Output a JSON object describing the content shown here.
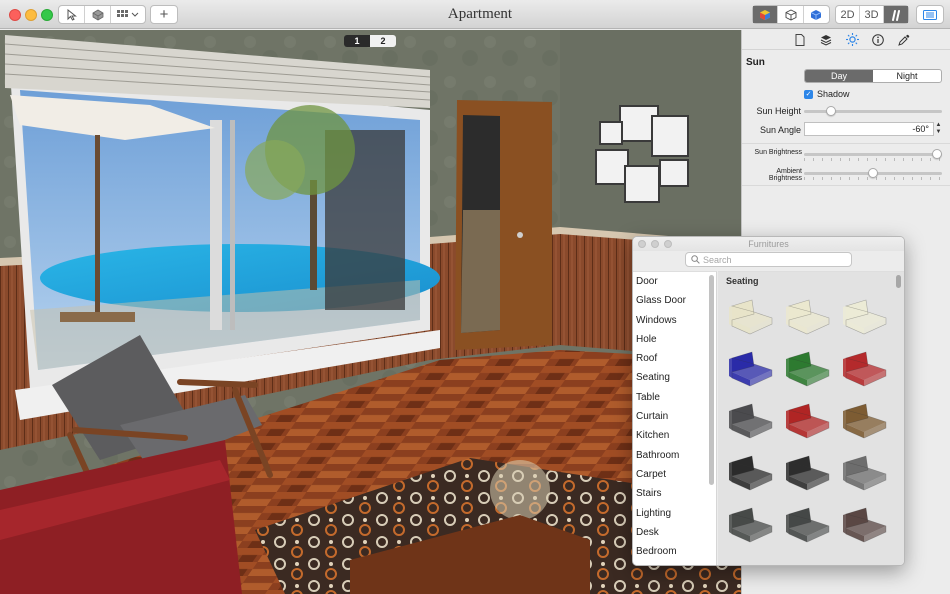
{
  "window": {
    "title": "Apartment"
  },
  "toolbar": {
    "left_buttons": [
      {
        "icon": "pointer-arrow-icon"
      },
      {
        "icon": "draw-wall-icon"
      },
      {
        "icon": "view-options-icon"
      },
      {
        "icon": "add-plus-icon",
        "label": "+"
      }
    ],
    "render_modes": [
      "solid-render-icon",
      "wireframe-render-icon",
      "textured-render-icon"
    ],
    "view_2d_label": "2D",
    "view_3d_label": "3D",
    "walk_icon": "walk-mode-icon",
    "sidebar_toggle_icon": "sidebar-toggle-icon"
  },
  "viewport": {
    "pages": [
      "1",
      "2"
    ],
    "active_page": "1"
  },
  "inspector": {
    "tab_icons": [
      "document-icon",
      "layers-icon",
      "sun-icon",
      "info-icon",
      "eyedropper-icon"
    ],
    "active_tab": "sun-icon",
    "heading": "Sun",
    "mode_options": [
      "Day",
      "Night"
    ],
    "mode_selected": "Day",
    "shadow_label": "Shadow",
    "shadow_checked": true,
    "sun_height_label": "Sun Height",
    "sun_height_value": 0.17,
    "sun_angle_label": "Sun Angle",
    "sun_angle_value": "-60°",
    "sun_brightness_label": "Sun Brightness",
    "sun_brightness_value": 1.0,
    "ambient_brightness_label": "Ambient Brightness",
    "ambient_brightness_value": 0.5
  },
  "furniture_panel": {
    "title": "Furnitures",
    "search_placeholder": "Search",
    "categories": [
      "Door",
      "Glass Door",
      "Windows",
      "Hole",
      "Roof",
      "Seating",
      "Table",
      "Curtain",
      "Kitchen",
      "Bathroom",
      "Carpet",
      "Stairs",
      "Lighting",
      "Desk",
      "Bedroom"
    ],
    "selected_category": "Seating",
    "section_title": "Seating",
    "items": [
      {
        "name": "white-armchair",
        "color": "#e8e4c9"
      },
      {
        "name": "white-loveseat",
        "color": "#ebe8cf"
      },
      {
        "name": "white-sofa",
        "color": "#ecebd6"
      },
      {
        "name": "blue-armchair",
        "color": "#2a2ba8"
      },
      {
        "name": "green-loveseat",
        "color": "#2d7a30"
      },
      {
        "name": "red-sofa",
        "color": "#b42a2c"
      },
      {
        "name": "gray-chaise",
        "color": "#4b4b4e"
      },
      {
        "name": "red-sectional",
        "color": "#b02524"
      },
      {
        "name": "brown-ottoman",
        "color": "#7d5c33"
      },
      {
        "name": "black-loveseat",
        "color": "#2b2b2b"
      },
      {
        "name": "black-armchair",
        "color": "#2d2d2d"
      },
      {
        "name": "gray-wood-armchair",
        "color": "#6d6d6d"
      },
      {
        "name": "dark-gray-armchair",
        "color": "#474a48"
      },
      {
        "name": "dark-gray-club-chair",
        "color": "#454847"
      },
      {
        "name": "curved-bench",
        "color": "#5a4744"
      }
    ]
  }
}
